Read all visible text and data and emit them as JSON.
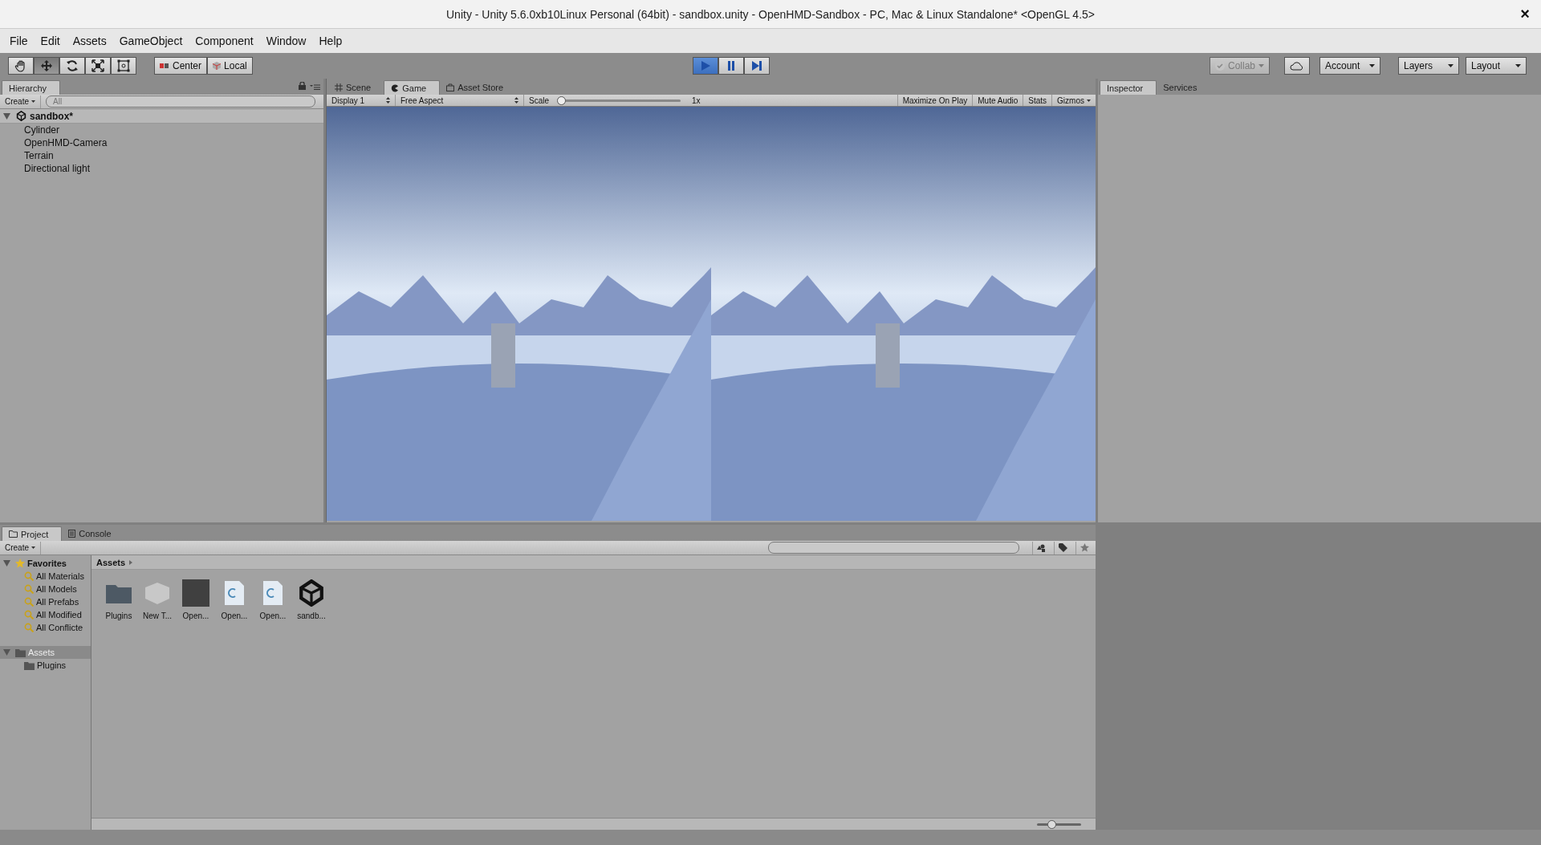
{
  "window": {
    "title": "Unity - Unity 5.6.0xb10Linux Personal (64bit) - sandbox.unity - OpenHMD-Sandbox - PC, Mac & Linux Standalone* <OpenGL 4.5>",
    "close": "×"
  },
  "menu": [
    "File",
    "Edit",
    "Assets",
    "GameObject",
    "Component",
    "Window",
    "Help"
  ],
  "tools": [
    {
      "kind": "hand",
      "selected": false
    },
    {
      "kind": "move",
      "selected": true
    },
    {
      "kind": "rotate",
      "selected": false
    },
    {
      "kind": "scale",
      "selected": false
    },
    {
      "kind": "rect",
      "selected": false
    }
  ],
  "pivot_buttons": [
    {
      "kind": "center",
      "label": "Center"
    },
    {
      "kind": "local",
      "label": "Local"
    }
  ],
  "play_controls": [
    {
      "kind": "play",
      "selected": true
    },
    {
      "kind": "pause",
      "selected": false
    },
    {
      "kind": "step",
      "selected": false
    }
  ],
  "right_toolbar": {
    "collab": {
      "label": "Collab",
      "disabled": true
    },
    "account": "Account",
    "layers": "Layers",
    "layout": "Layout"
  },
  "hierarchy": {
    "tab": "Hierarchy",
    "create": "Create",
    "search_placeholder": "All",
    "scene": "sandbox*",
    "items": [
      "Cylinder",
      "OpenHMD-Camera",
      "Terrain",
      "Directional light"
    ]
  },
  "center_tabs": [
    {
      "kind": "scene",
      "label": "Scene",
      "selected": false
    },
    {
      "kind": "game",
      "label": "Game",
      "selected": true
    },
    {
      "kind": "store",
      "label": "Asset Store",
      "selected": false
    }
  ],
  "game_toolbar": {
    "display": "Display 1",
    "aspect": "Free Aspect",
    "scale_label": "Scale",
    "scale": {
      "level": 0.0
    },
    "scale_value": "1x",
    "toggles": [
      {
        "label": "Maximize On Play",
        "on": false
      },
      {
        "label": "Mute Audio",
        "on": false
      },
      {
        "label": "Stats",
        "on": false
      }
    ],
    "gizmos": "Gizmos"
  },
  "inspector_tabs": [
    {
      "label": "Inspector",
      "selected": true
    },
    {
      "label": "Services",
      "selected": false
    }
  ],
  "project": {
    "tabs": [
      {
        "kind": "project",
        "label": "Project",
        "selected": true
      },
      {
        "kind": "console",
        "label": "Console",
        "selected": false
      }
    ],
    "create": "Create",
    "favorites": {
      "label": "Favorites",
      "expanded": true,
      "children": [
        "All Materials",
        "All Models",
        "All Prefabs",
        "All Modified",
        "All Conflicte"
      ]
    },
    "tree": [
      {
        "label": "Assets",
        "selected": true,
        "expanded": true,
        "children": [
          {
            "label": "Plugins",
            "selected": false
          }
        ]
      }
    ],
    "breadcrumb": "Assets",
    "assets": [
      {
        "kind": "folder",
        "label": "Plugins"
      },
      {
        "kind": "model",
        "label": "New T..."
      },
      {
        "kind": "material",
        "label": "Open..."
      },
      {
        "kind": "script",
        "label": "Open..."
      },
      {
        "kind": "script",
        "label": "Open..."
      },
      {
        "kind": "scene",
        "label": "sandb..."
      }
    ],
    "zoom": {
      "level": 0.3
    }
  }
}
